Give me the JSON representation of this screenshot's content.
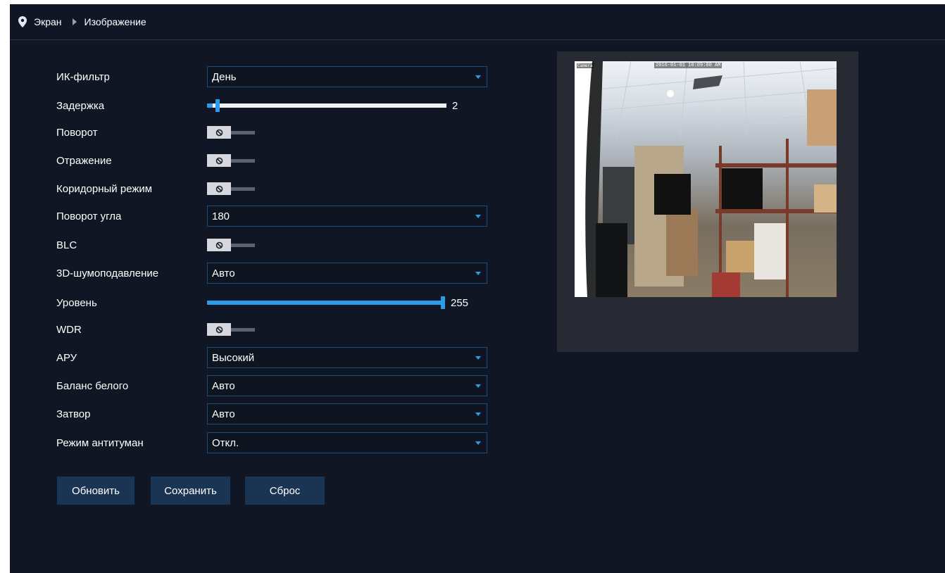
{
  "breadcrumb": {
    "icon": "location-pin-icon",
    "items": [
      "Экран",
      "Изображение"
    ],
    "separator_icon": "triangle-right-icon"
  },
  "settings": {
    "ir_filter": {
      "label": "ИК-фильтр",
      "value": "День"
    },
    "delay": {
      "label": "Задержка",
      "value": "2",
      "level": 0.02
    },
    "rotate": {
      "label": "Поворот",
      "state": "off"
    },
    "mirror": {
      "label": "Отражение",
      "state": "off"
    },
    "corridor": {
      "label": "Коридорный режим",
      "state": "off"
    },
    "rotate_angle": {
      "label": "Поворот угла",
      "value": "180"
    },
    "blc": {
      "label": "BLC",
      "state": "off"
    },
    "noise3d": {
      "label": "3D-шумоподавление",
      "value": "Авто"
    },
    "level": {
      "label": "Уровень",
      "value": "255",
      "level": 1.0
    },
    "wdr": {
      "label": "WDR",
      "state": "off"
    },
    "agc": {
      "label": "АРУ",
      "value": "Высокий"
    },
    "white_balance": {
      "label": "Баланс белого",
      "value": "Авто"
    },
    "shutter": {
      "label": "Затвор",
      "value": "Авто"
    },
    "defog": {
      "label": "Режим антитуман",
      "value": "Откл."
    }
  },
  "buttons": {
    "refresh": "Обновить",
    "save": "Сохранить",
    "reset": "Сброс"
  },
  "preview": {
    "osd_camera": "Camera",
    "osd_timestamp": "2016-01-01 10:09:00 AM"
  },
  "colors": {
    "background": "#101624",
    "accent": "#2b9bea",
    "button": "#1a3553"
  }
}
